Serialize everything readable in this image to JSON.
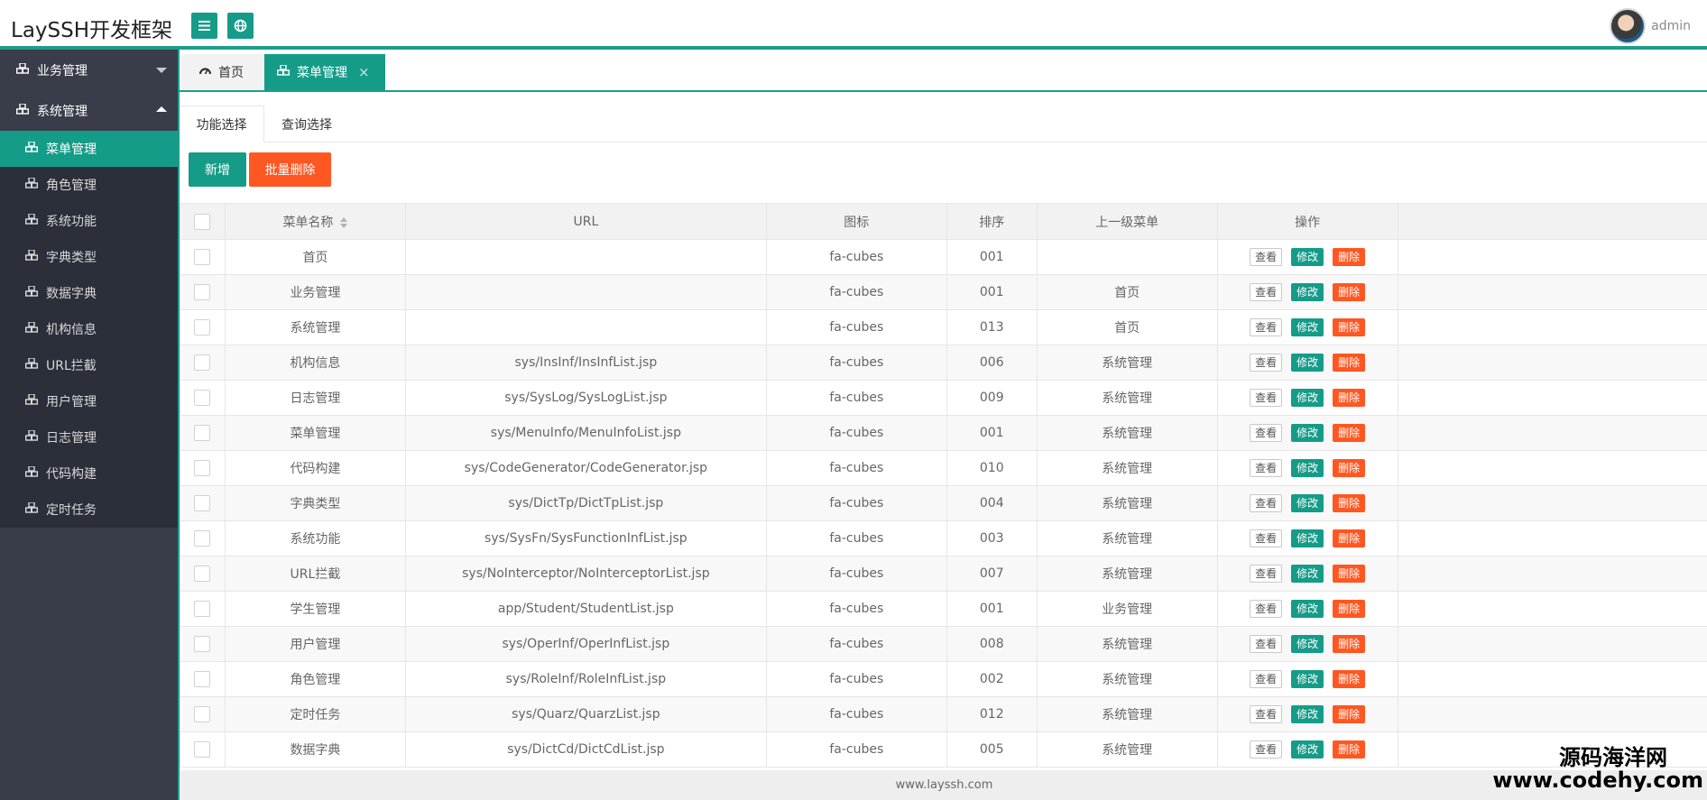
{
  "header": {
    "logo": "LaySSH开发框架",
    "user_name": "admin"
  },
  "sidebar": {
    "groups": [
      {
        "label": "业务管理",
        "expanded": false
      },
      {
        "label": "系统管理",
        "expanded": true
      }
    ],
    "items": [
      {
        "label": "菜单管理",
        "active": true
      },
      {
        "label": "角色管理"
      },
      {
        "label": "系统功能"
      },
      {
        "label": "字典类型"
      },
      {
        "label": "数据字典"
      },
      {
        "label": "机构信息"
      },
      {
        "label": "URL拦截"
      },
      {
        "label": "用户管理"
      },
      {
        "label": "日志管理"
      },
      {
        "label": "代码构建"
      },
      {
        "label": "定时任务"
      }
    ]
  },
  "tabs": [
    {
      "label": "首页"
    },
    {
      "label": "菜单管理",
      "active": true,
      "close": "×"
    }
  ],
  "subtabs": [
    {
      "label": "功能选择",
      "active": true
    },
    {
      "label": "查询选择"
    }
  ],
  "toolbar": {
    "add_label": "新增",
    "batch_delete_label": "批量删除"
  },
  "table": {
    "columns": [
      "菜单名称",
      "URL",
      "图标",
      "排序",
      "上一级菜单",
      "操作"
    ],
    "actions": {
      "view": "查看",
      "edit": "修改",
      "delete": "删除"
    },
    "rows": [
      {
        "name": "首页",
        "url": "",
        "icon": "fa-cubes",
        "order": "001",
        "parent": ""
      },
      {
        "name": "业务管理",
        "url": "",
        "icon": "fa-cubes",
        "order": "001",
        "parent": "首页"
      },
      {
        "name": "系统管理",
        "url": "",
        "icon": "fa-cubes",
        "order": "013",
        "parent": "首页"
      },
      {
        "name": "机构信息",
        "url": "sys/InsInf/InsInfList.jsp",
        "icon": "fa-cubes",
        "order": "006",
        "parent": "系统管理"
      },
      {
        "name": "日志管理",
        "url": "sys/SysLog/SysLogList.jsp",
        "icon": "fa-cubes",
        "order": "009",
        "parent": "系统管理"
      },
      {
        "name": "菜单管理",
        "url": "sys/MenuInfo/MenuInfoList.jsp",
        "icon": "fa-cubes",
        "order": "001",
        "parent": "系统管理"
      },
      {
        "name": "代码构建",
        "url": "sys/CodeGenerator/CodeGenerator.jsp",
        "icon": "fa-cubes",
        "order": "010",
        "parent": "系统管理"
      },
      {
        "name": "字典类型",
        "url": "sys/DictTp/DictTpList.jsp",
        "icon": "fa-cubes",
        "order": "004",
        "parent": "系统管理"
      },
      {
        "name": "系统功能",
        "url": "sys/SysFn/SysFunctionInfList.jsp",
        "icon": "fa-cubes",
        "order": "003",
        "parent": "系统管理"
      },
      {
        "name": "URL拦截",
        "url": "sys/NoInterceptor/NoInterceptorList.jsp",
        "icon": "fa-cubes",
        "order": "007",
        "parent": "系统管理"
      },
      {
        "name": "学生管理",
        "url": "app/Student/StudentList.jsp",
        "icon": "fa-cubes",
        "order": "001",
        "parent": "业务管理"
      },
      {
        "name": "用户管理",
        "url": "sys/OperInf/OperInfList.jsp",
        "icon": "fa-cubes",
        "order": "008",
        "parent": "系统管理"
      },
      {
        "name": "角色管理",
        "url": "sys/RoleInf/RoleInfList.jsp",
        "icon": "fa-cubes",
        "order": "002",
        "parent": "系统管理"
      },
      {
        "name": "定时任务",
        "url": "sys/Quarz/QuarzList.jsp",
        "icon": "fa-cubes",
        "order": "012",
        "parent": "系统管理"
      },
      {
        "name": "数据字典",
        "url": "sys/DictCd/DictCdList.jsp",
        "icon": "fa-cubes",
        "order": "005",
        "parent": "系统管理"
      }
    ]
  },
  "footer": {
    "text": "www.layssh.com"
  },
  "watermark": {
    "line1": "源码海洋网",
    "line2": "www.codehy.com"
  },
  "colors": {
    "accent": "#159c88",
    "danger": "#ff5722",
    "sidebar": "#393d49"
  }
}
